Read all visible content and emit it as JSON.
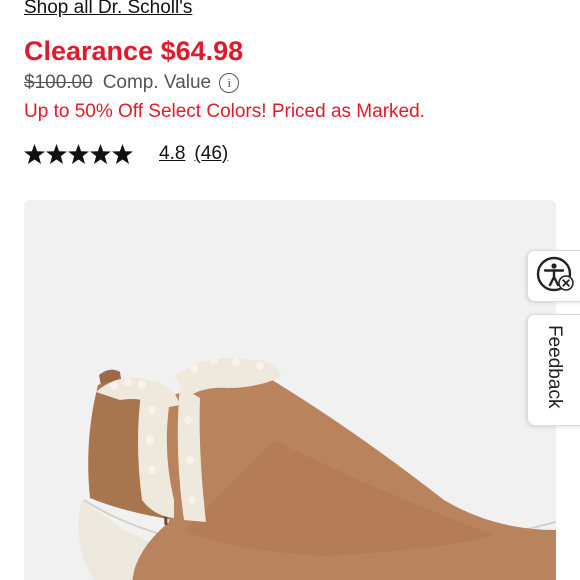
{
  "header": {
    "brand_link": "Shop all Dr. Scholl's"
  },
  "pricing": {
    "sale_price": "Clearance $64.98",
    "original_price": "$100.00",
    "comp_label": "Comp. Value",
    "info_icon": "info-icon",
    "promo_text": "Up to 50% Off Select Colors! Priced as Marked."
  },
  "rating": {
    "stars": 5,
    "value": "4.8",
    "count": "(46)"
  },
  "side_tabs": {
    "accessibility_icon": "accessibility-icon",
    "feedback_label": "Feedback"
  },
  "colors": {
    "sale_red": "#e01a2b",
    "panel_bg": "#f1f1f1",
    "boot_tan": "#b9835d",
    "shearling": "#efe8dc",
    "sole": "#ece8de"
  }
}
